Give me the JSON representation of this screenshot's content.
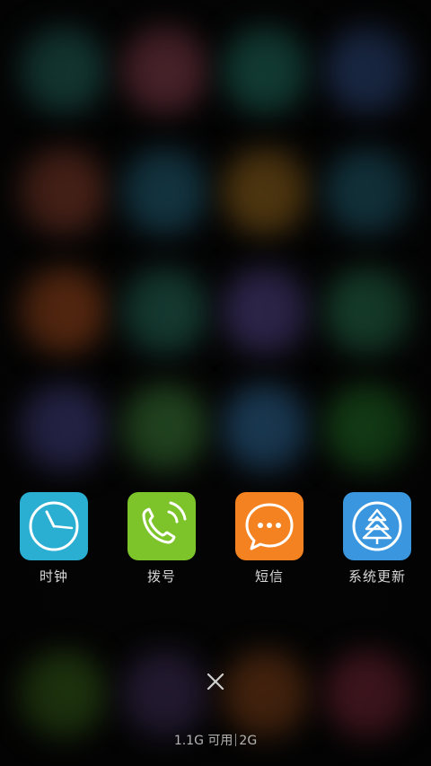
{
  "recent_apps": [
    {
      "label": "时钟",
      "icon": "clock-icon",
      "color": "#2AAED2"
    },
    {
      "label": "拨号",
      "icon": "phone-icon",
      "color": "#7CC42A"
    },
    {
      "label": "短信",
      "icon": "message-icon",
      "color": "#F58220"
    },
    {
      "label": "系统更新",
      "icon": "system-update-icon",
      "color": "#3A97DF"
    }
  ],
  "close_all": {
    "icon": "close-icon"
  },
  "memory": {
    "available": "1.1G 可用",
    "total": "2G"
  },
  "background_colors": {
    "row1": [
      "#1a4a44",
      "#5a2a34",
      "#164a40",
      "#22365c"
    ],
    "row2": [
      "#5a2a1e",
      "#163c4a",
      "#5a3e12",
      "#173f4c"
    ],
    "row3": [
      "#6a3114",
      "#163e34",
      "#302850",
      "#1a4a34"
    ],
    "row4": [
      "#2e2c58",
      "#244a22",
      "#1c3e5a",
      "#174a1a"
    ],
    "row5": [
      "#2a4a14",
      "#2e2240",
      "#5a2e12",
      "#5a1e2a"
    ]
  }
}
